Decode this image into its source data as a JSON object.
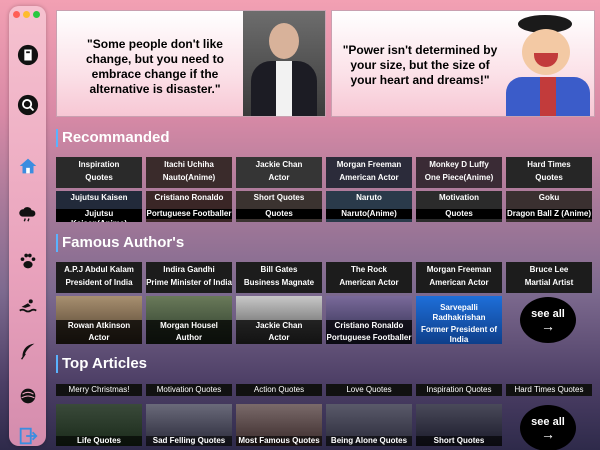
{
  "window": {
    "traffic_colors": [
      "#ff5f57",
      "#febc2e",
      "#28c840"
    ]
  },
  "sidebar": {
    "items": [
      {
        "name": "quotes-app-icon"
      },
      {
        "name": "search-icon"
      },
      {
        "name": "home-icon"
      },
      {
        "name": "cloud-icon"
      },
      {
        "name": "paw-icon"
      },
      {
        "name": "swimming-icon"
      },
      {
        "name": "feather-icon"
      },
      {
        "name": "yarn-icon"
      },
      {
        "name": "logout-icon"
      }
    ]
  },
  "featured": [
    {
      "text": "\"Some people don't like change, but you need to embrace change if the alternative is disaster.\""
    },
    {
      "text": "\"Power isn't determined by your size, but the size of your heart and dreams!\""
    }
  ],
  "sections": {
    "recommended": "Recommanded",
    "famous_authors": "Famous Author's",
    "top_articles": "Top Articles"
  },
  "recommended": [
    {
      "title": "Inspiration",
      "subtitle": "Quotes"
    },
    {
      "title": "Itachi Uchiha",
      "subtitle": "Nauto(Anime)"
    },
    {
      "title": "Jackie Chan",
      "subtitle": "Actor"
    },
    {
      "title": "Morgan Freeman",
      "subtitle": "American Actor"
    },
    {
      "title": "Monkey D Luffy",
      "subtitle": "One Piece(Anime)"
    },
    {
      "title": "Hard Times",
      "subtitle": "Quotes"
    },
    {
      "title": "Jujutsu Kaisen",
      "subtitle": "Jujutsu Kaisen(Anime)"
    },
    {
      "title": "Cristiano Ronaldo",
      "subtitle": "Portuguese Footballer"
    },
    {
      "title": "Short Quotes",
      "subtitle": "Quotes"
    },
    {
      "title": "Naruto",
      "subtitle": "Naruto(Anime)"
    },
    {
      "title": "Motivation",
      "subtitle": "Quotes"
    },
    {
      "title": "Goku",
      "subtitle": "Dragon Ball Z (Anime)"
    }
  ],
  "authors_top": [
    {
      "title": "A.P.J Abdul Kalam",
      "subtitle": "President of India"
    },
    {
      "title": "Indira Gandhi",
      "subtitle": "Prime Minister of India"
    },
    {
      "title": "Bill Gates",
      "subtitle": "Business Magnate"
    },
    {
      "title": "The Rock",
      "subtitle": "American Actor"
    },
    {
      "title": "Morgan Freeman",
      "subtitle": "American Actor"
    },
    {
      "title": "Bruce Lee",
      "subtitle": "Martial Artist"
    }
  ],
  "authors_bottom": [
    {
      "title": "Rowan Atkinson",
      "subtitle": "Actor"
    },
    {
      "title": "Morgan Housel",
      "subtitle": "Author"
    },
    {
      "title": "Jackie Chan",
      "subtitle": "Actor"
    },
    {
      "title": "Cristiano Ronaldo",
      "subtitle": "Portuguese Footballer"
    },
    {
      "title": "Sarvepalli Radhakrishan",
      "subtitle": "Former President of India"
    }
  ],
  "see_all": {
    "label": "see all",
    "arrow": "→"
  },
  "articles_labels": [
    "Merry Christmas!",
    "Motivation Quotes",
    "Action Quotes",
    "Love Quotes",
    "Inspiration Quotes",
    "Hard Times Quotes"
  ],
  "articles_photos": [
    "Life Quotes",
    "Sad Felling Quotes",
    "Most Famous Quotes",
    "Being Alone Quotes",
    "Short Quotes"
  ]
}
